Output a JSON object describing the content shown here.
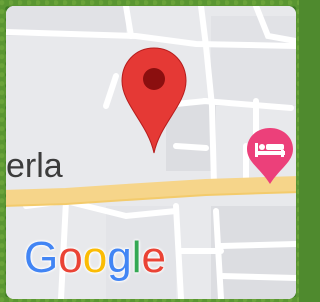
{
  "map": {
    "place_label": "erla",
    "logo": {
      "text": "Google",
      "letters": [
        {
          "char": "G",
          "color": "#4285F4"
        },
        {
          "char": "o",
          "color": "#EA4335"
        },
        {
          "char": "o",
          "color": "#FBBC05"
        },
        {
          "char": "g",
          "color": "#4285F4"
        },
        {
          "char": "l",
          "color": "#34A853"
        },
        {
          "char": "e",
          "color": "#EA4335"
        }
      ]
    },
    "markers": [
      {
        "icon": "location-pin-icon",
        "color": "#E53935"
      },
      {
        "icon": "hotel-bed-icon",
        "color": "#EC407A"
      }
    ],
    "colors": {
      "land": "#E8E9EC",
      "road": "#FFFFFF",
      "major_road": "#F6D58A",
      "block": "#DCDDE1"
    }
  }
}
